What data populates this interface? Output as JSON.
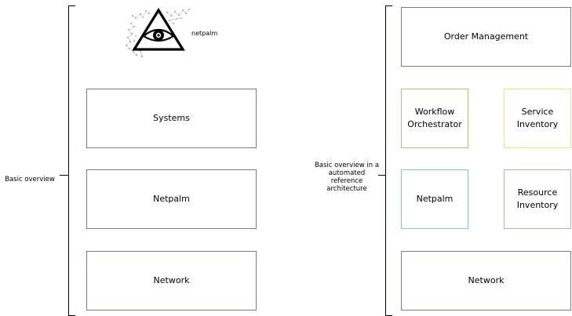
{
  "left": {
    "label": "Basic overview",
    "logo_text": "netpalm",
    "boxes": [
      "Systems",
      "Netpalm",
      "Network"
    ]
  },
  "right": {
    "label": "Basic overview in a\nautomated\nreference\narchitecture",
    "boxes": {
      "order_management": "Order Management",
      "workflow_orchestrator": "Workflow\nOrchestrator",
      "service_inventory": "Service\nInventory",
      "netpalm": "Netpalm",
      "resource_inventory": "Resource\nInventory",
      "network": "Network"
    }
  },
  "colors": {
    "default_border": "#7f73a8",
    "workflow_border": "#b5bf77",
    "service_border": "#f3e37e",
    "netpalm_right_border": "#7ec3cf",
    "resource_border": "#e2a2a2"
  }
}
